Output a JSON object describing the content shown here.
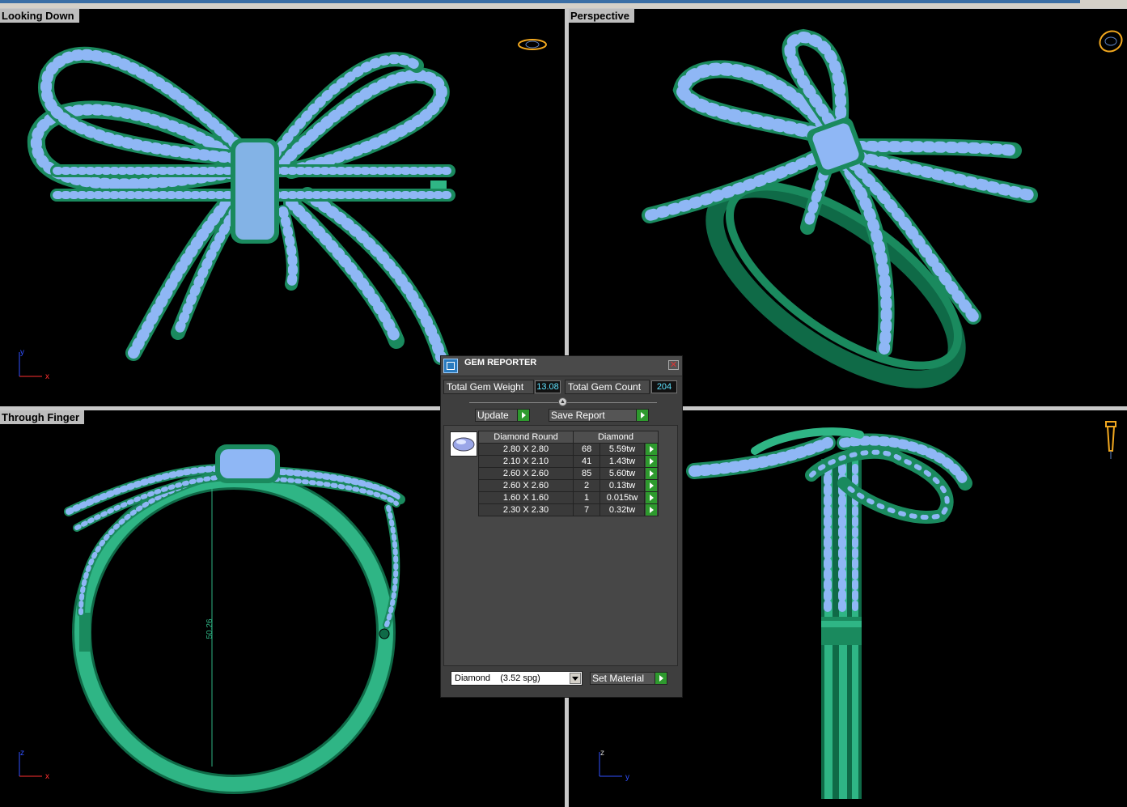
{
  "viewports": [
    {
      "id": "top-left",
      "title": "Looking Down",
      "axes": [
        "y",
        "x"
      ]
    },
    {
      "id": "top-right",
      "title": "Perspective",
      "axes": []
    },
    {
      "id": "bottom-left",
      "title": "Through Finger",
      "axes": [
        "z",
        "x"
      ],
      "dimension": "50.26"
    },
    {
      "id": "bottom-right",
      "title": "",
      "axes": [
        "z",
        "y"
      ]
    }
  ],
  "gem_reporter": {
    "title": "GEM REPORTER",
    "close": "✕",
    "total_weight_label": "Total Gem Weight",
    "total_weight_value": "13.08",
    "total_count_label": "Total Gem Count",
    "total_count_value": "204",
    "update_label": "Update",
    "save_report_label": "Save Report",
    "table_headers": [
      "Diamond Round",
      "Diamond"
    ],
    "rows": [
      {
        "size": "2.80 X 2.80",
        "count": "68",
        "weight": "5.59tw"
      },
      {
        "size": "2.10 X 2.10",
        "count": "41",
        "weight": "1.43tw"
      },
      {
        "size": "2.60 X 2.60",
        "count": "85",
        "weight": "5.60tw"
      },
      {
        "size": "2.60 X 2.60",
        "count": "2",
        "weight": "0.13tw"
      },
      {
        "size": "1.60 X 1.60",
        "count": "1",
        "weight": "0.015tw"
      },
      {
        "size": "2.30 X 2.30",
        "count": "7",
        "weight": "0.32tw"
      }
    ],
    "material_select": "Diamond    (3.52 spg)",
    "set_material_label": "Set Material"
  },
  "colors": {
    "metal": "#1a8a5e",
    "metal_light": "#2fb585",
    "gem": "#8fb7f5",
    "prong": "#9b2fc9",
    "viewport_bg": "#000000",
    "cube_icon": "#f2a81f"
  }
}
